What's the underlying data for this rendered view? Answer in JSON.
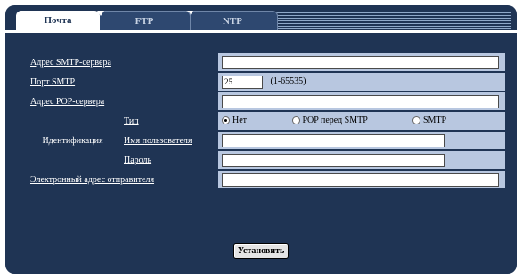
{
  "tabs": {
    "mail": "Почта",
    "ftp": "FTP",
    "ntp": "NTP"
  },
  "smtp_server": {
    "label": "Адрес SMTP-сервера",
    "value": ""
  },
  "smtp_port": {
    "label": "Порт SMTP",
    "value": "25",
    "range": "(1-65535)"
  },
  "pop_server": {
    "label": "Адрес POP-сервера",
    "value": ""
  },
  "auth": {
    "label": "Идентификация",
    "type_label": "Тип",
    "options": [
      "Нет",
      "POP перед SMTP",
      "SMTP"
    ],
    "selected": "Нет",
    "username_label": "Имя пользователя",
    "username_value": "",
    "password_label": "Пароль",
    "password_value": ""
  },
  "sender_email": {
    "label": "Электронный адрес отправителя",
    "value": ""
  },
  "submit_label": "Установить"
}
